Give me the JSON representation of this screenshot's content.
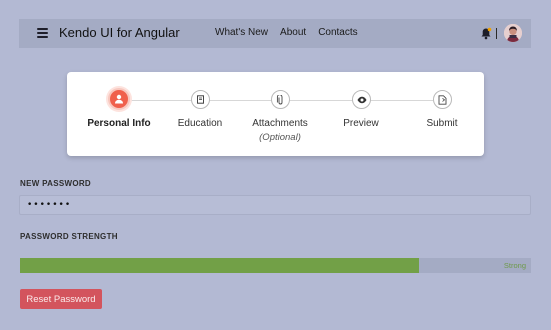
{
  "header": {
    "title": "Kendo UI for Angular",
    "menu_icon": "hamburger-menu-icon",
    "nav": [
      {
        "label": "What's New"
      },
      {
        "label": "About"
      },
      {
        "label": "Contacts"
      }
    ],
    "notification_icon": "bell-icon",
    "avatar": "user-avatar"
  },
  "stepper": {
    "active_index": 0,
    "active_color": "#f0604c",
    "steps": [
      {
        "label": "Personal Info",
        "icon": "user-icon",
        "sublabel": ""
      },
      {
        "label": "Education",
        "icon": "book-icon",
        "sublabel": ""
      },
      {
        "label": "Attachments",
        "icon": "paperclip-icon",
        "sublabel": "(Optional)"
      },
      {
        "label": "Preview",
        "icon": "eye-icon",
        "sublabel": ""
      },
      {
        "label": "Submit",
        "icon": "file-submit-icon",
        "sublabel": ""
      }
    ]
  },
  "form": {
    "new_password_label": "NEW PASSWORD",
    "password_value": "•••••••",
    "strength_label": "PASSWORD STRENGTH",
    "strength_value": 0.78,
    "strength_text": "Strong",
    "strength_color": "#72a047",
    "reset_button": "Reset Password",
    "reset_color": "#d3545d"
  }
}
